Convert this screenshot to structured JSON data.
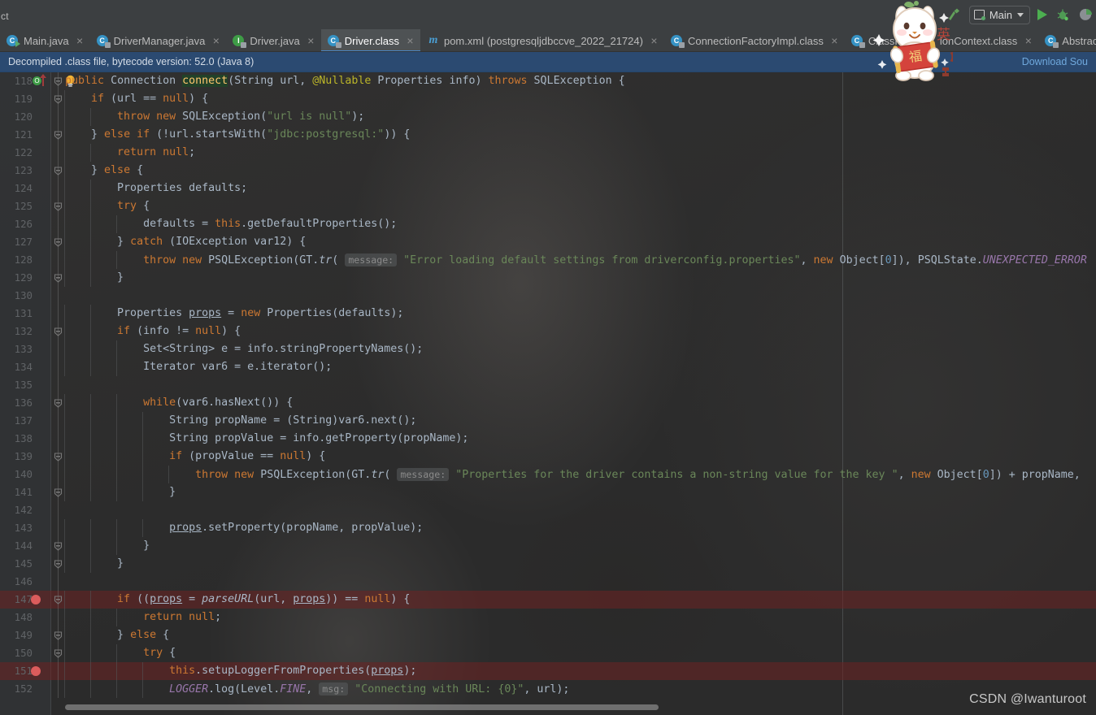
{
  "window": {
    "project_label_partial": "ct",
    "watermark": "CSDN @Iwanturoot"
  },
  "toolbar": {
    "run_config_name": "Main",
    "icons": [
      "build-hammer-icon",
      "run-config-selector",
      "run-icon",
      "debug-icon",
      "coverage-icon"
    ]
  },
  "tabs": [
    {
      "label": "Main.java",
      "icon": "java-class-run-icon",
      "active": false,
      "close": "×"
    },
    {
      "label": "DriverManager.java",
      "icon": "java-class-library-icon",
      "active": false,
      "close": "×"
    },
    {
      "label": "Driver.java",
      "icon": "java-interface-icon",
      "active": false,
      "close": "×"
    },
    {
      "label": "Driver.class",
      "icon": "java-class-library-icon",
      "active": true,
      "close": "×"
    },
    {
      "label": "pom.xml (postgresqljdbccve_2022_21724)",
      "icon": "maven-icon",
      "active": false,
      "close": "×"
    },
    {
      "label": "ConnectionFactoryImpl.class",
      "icon": "java-class-library-icon",
      "active": false,
      "close": "×"
    },
    {
      "label": "ClassPat",
      "icon": "java-class-library-icon",
      "active": false,
      "close": ""
    },
    {
      "label": "ionContext.class",
      "icon": "none",
      "active": false,
      "close": "×"
    },
    {
      "label": "Abstract",
      "icon": "java-class-library-icon",
      "active": false,
      "close": ""
    }
  ],
  "banner": {
    "text": "Decompiled .class file, bytecode version: 52.0 (Java 8)",
    "link": "Download Sou"
  },
  "editor": {
    "first_visible_line": 118,
    "breakpoint_lines": [
      147,
      151
    ],
    "highlighted_lines": [
      147,
      151
    ],
    "lines": [
      {
        "n": 118,
        "html": "<span class=\"kw\">public</span> <span class=\"cls\">Connection</span> <span class=\"mtd sel\">connect</span>(<span class=\"cls\">String</span> url, <span class=\"ann\">@Nullable</span> <span class=\"cls\">Properties</span> info) <span class=\"kw\">throws</span> <span class=\"cls\">SQLException</span> {",
        "indent": 0
      },
      {
        "n": 119,
        "html": "    <span class=\"kw\">if</span> (url == <span class=\"kw\">null</span>) {",
        "indent": 1
      },
      {
        "n": 120,
        "html": "        <span class=\"kw\">throw new</span> <span class=\"cls\">SQLException</span>(<span class=\"str\">\"url is null\"</span>);",
        "indent": 2
      },
      {
        "n": 121,
        "html": "    } <span class=\"kw\">else if</span> (!url.startsWith(<span class=\"str\">\"jdbc:postgresql:\"</span>)) {",
        "indent": 1
      },
      {
        "n": 122,
        "html": "        <span class=\"kw\">return null</span>;",
        "indent": 2
      },
      {
        "n": 123,
        "html": "    } <span class=\"kw\">else</span> {",
        "indent": 1
      },
      {
        "n": 124,
        "html": "        <span class=\"cls\">Properties</span> defaults;",
        "indent": 2
      },
      {
        "n": 125,
        "html": "        <span class=\"kw\">try</span> {",
        "indent": 2
      },
      {
        "n": 126,
        "html": "            defaults = <span class=\"kw\">this</span>.getDefaultProperties();",
        "indent": 3
      },
      {
        "n": 127,
        "html": "        } <span class=\"kw\">catch</span> (<span class=\"cls\">IOException</span> var12) {",
        "indent": 2
      },
      {
        "n": 128,
        "html": "            <span class=\"kw\">throw new</span> <span class=\"cls\">PSQLException</span>(<span class=\"cls\">GT</span>.<span class=\"smtd\">tr</span>( <span class=\"hint\">message:</span> <span class=\"str\">\"Error loading default settings from driverconfig.properties\"</span>, <span class=\"kw\">new</span> <span class=\"cls\">Object</span>[<span class=\"num\">0</span>]), <span class=\"cls\">PSQLState</span>.<span class=\"sfld\">UNEXPECTED_ERROR</span>",
        "indent": 3
      },
      {
        "n": 129,
        "html": "        }",
        "indent": 2
      },
      {
        "n": 130,
        "html": "",
        "indent": 0
      },
      {
        "n": 131,
        "html": "        <span class=\"cls\">Properties</span> <span class=\"uline\">props</span> = <span class=\"kw\">new</span> <span class=\"cls\">Properties</span>(defaults);",
        "indent": 2
      },
      {
        "n": 132,
        "html": "        <span class=\"kw\">if</span> (info != <span class=\"kw\">null</span>) {",
        "indent": 2
      },
      {
        "n": 133,
        "html": "            <span class=\"cls\">Set&lt;String&gt;</span> e = info.stringPropertyNames();",
        "indent": 3
      },
      {
        "n": 134,
        "html": "            <span class=\"cls\">Iterator</span> var6 = e.iterator();",
        "indent": 3
      },
      {
        "n": 135,
        "html": "",
        "indent": 0
      },
      {
        "n": 136,
        "html": "            <span class=\"kw\">while</span>(var6.hasNext()) {",
        "indent": 3
      },
      {
        "n": 137,
        "html": "                <span class=\"cls\">String</span> propName = (<span class=\"cls\">String</span>)var6.next();",
        "indent": 4
      },
      {
        "n": 138,
        "html": "                <span class=\"cls\">String</span> propValue = info.getProperty(propName);",
        "indent": 4
      },
      {
        "n": 139,
        "html": "                <span class=\"kw\">if</span> (propValue == <span class=\"kw\">null</span>) {",
        "indent": 4
      },
      {
        "n": 140,
        "html": "                    <span class=\"kw\">throw new</span> <span class=\"cls\">PSQLException</span>(<span class=\"cls\">GT</span>.<span class=\"smtd\">tr</span>( <span class=\"hint\">message:</span> <span class=\"str\">\"Properties for the driver contains a non-string value for the key \"</span>, <span class=\"kw\">new</span> <span class=\"cls\">Object</span>[<span class=\"num\">0</span>]) + propName,",
        "indent": 5
      },
      {
        "n": 141,
        "html": "                }",
        "indent": 4
      },
      {
        "n": 142,
        "html": "",
        "indent": 0
      },
      {
        "n": 143,
        "html": "                <span class=\"uline\">props</span>.setProperty(propName, propValue);",
        "indent": 4
      },
      {
        "n": 144,
        "html": "            }",
        "indent": 3
      },
      {
        "n": 145,
        "html": "        }",
        "indent": 2
      },
      {
        "n": 146,
        "html": "",
        "indent": 0
      },
      {
        "n": 147,
        "html": "        <span class=\"kw\">if</span> ((<span class=\"uline\">props</span> = <span class=\"smtd\">parseURL</span>(url, <span class=\"uline\">props</span>)) == <span class=\"kw\">null</span>) {",
        "indent": 2
      },
      {
        "n": 148,
        "html": "            <span class=\"kw\">return null</span>;",
        "indent": 3
      },
      {
        "n": 149,
        "html": "        } <span class=\"kw\">else</span> {",
        "indent": 2
      },
      {
        "n": 150,
        "html": "            <span class=\"kw\">try</span> {",
        "indent": 3
      },
      {
        "n": 151,
        "html": "                <span class=\"kw\">this</span>.setupLoggerFromProperties(<span class=\"uline\">props</span>);",
        "indent": 4
      },
      {
        "n": 152,
        "html": "                <span class=\"sfld\">LOGGER</span>.log(<span class=\"cls\">Level</span>.<span class=\"sfld\">FINE</span>, <span class=\"hint\">msg:</span> <span class=\"str\">\"Connecting with URL: {0}\"</span>, url);",
        "indent": 4
      }
    ],
    "fold_lines": [
      118,
      119,
      121,
      123,
      125,
      127,
      129,
      132,
      136,
      139,
      141,
      144,
      145,
      147,
      149,
      150
    ],
    "fold_collapsed_lines": [
      121,
      123,
      127,
      129,
      141,
      144,
      145,
      149
    ]
  },
  "colors": {
    "editor_bg": "#2b2b2b",
    "gutter_bg": "#313335",
    "chrome_bg": "#3c3f41",
    "tab_active_bg": "#4e5254",
    "tab_active_underline": "#4a88c7",
    "banner_bg": "#2b4a71",
    "banner_link": "#6fa8dc",
    "keyword": "#cc7832",
    "string": "#6a8759",
    "number": "#6897bb",
    "annotation": "#bbb529",
    "field": "#9876aa",
    "method": "#ffc66d",
    "default_text": "#a9b7c6",
    "breakpoint": "#db5c5c",
    "highlight_row": "#6e2323",
    "run_green": "#4caf50"
  },
  "mascot": {
    "name": "bunny-sticker",
    "scroll_text": "福"
  }
}
